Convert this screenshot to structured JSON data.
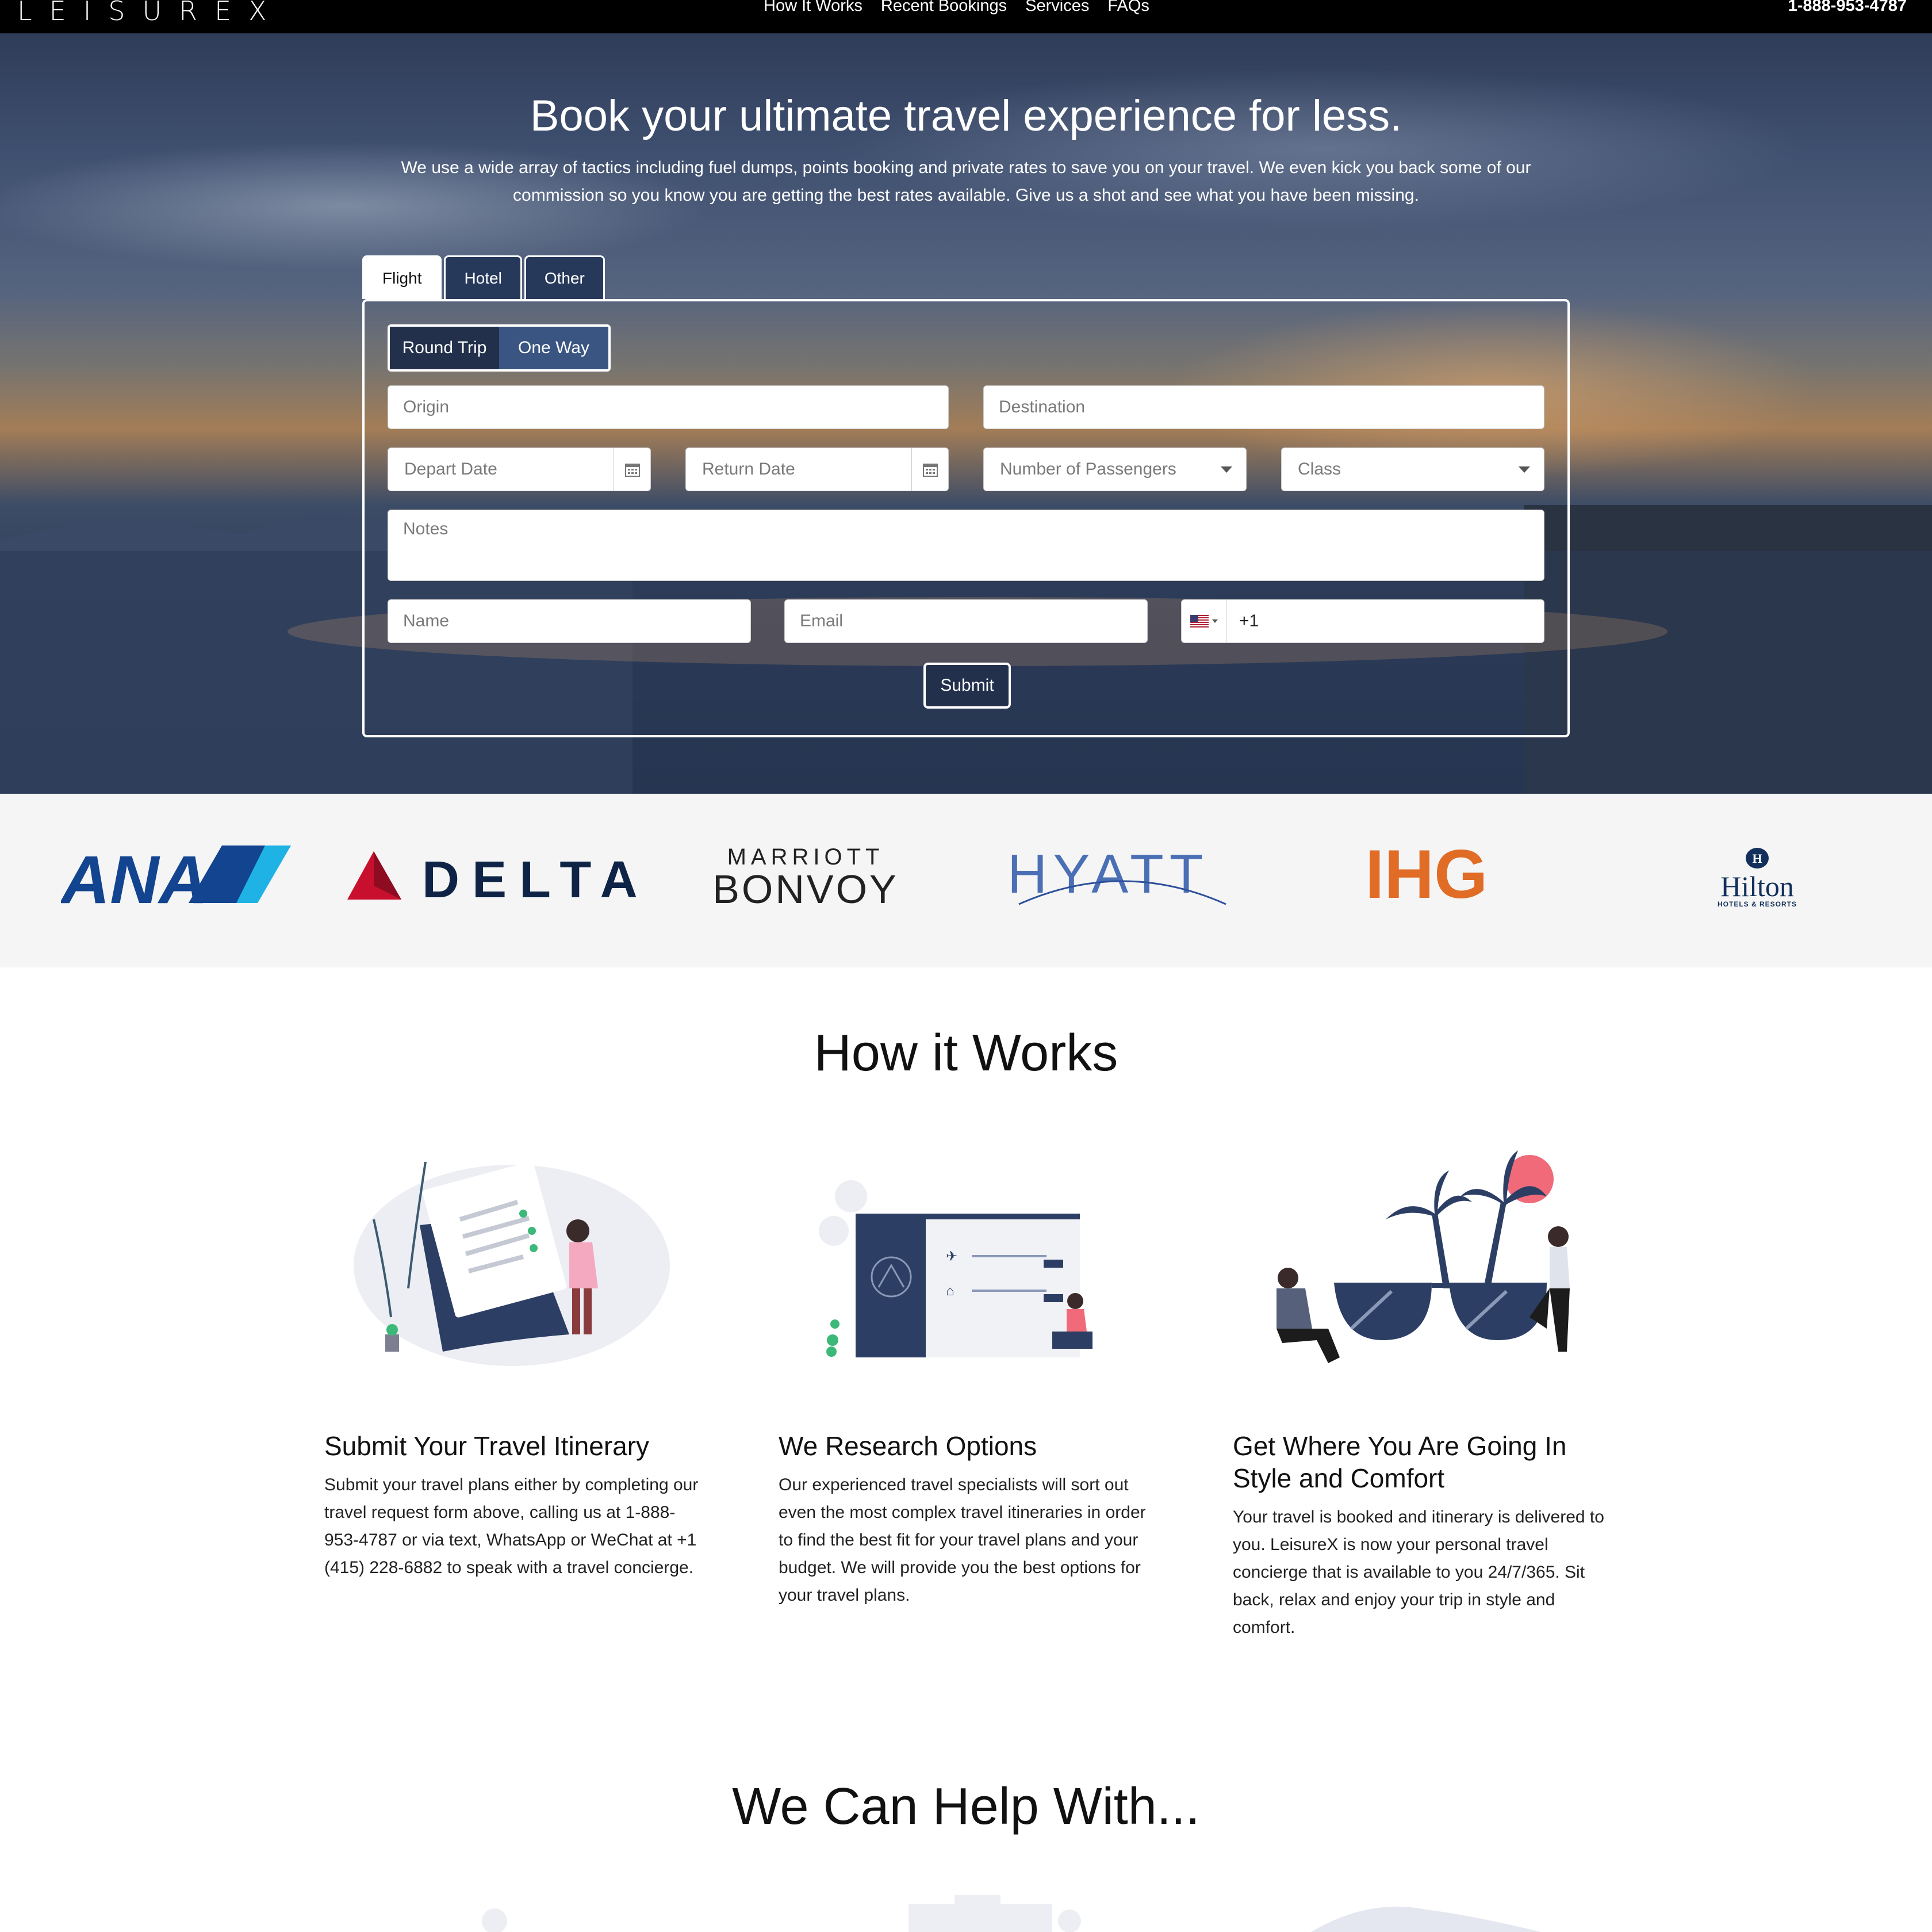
{
  "nav": {
    "logo": "LEISUREX",
    "links": [
      "How It Works",
      "Recent Bookings",
      "Services",
      "FAQs"
    ],
    "phone": "1-888-953-4787"
  },
  "hero": {
    "title": "Book your ultimate travel experience for less.",
    "subtitle": "We use a wide array of tactics including fuel dumps, points booking and private rates to save you on your travel. We even kick you back some of our commission so you know you are getting the best rates available. Give us a shot and see what you have been missing."
  },
  "tabs": [
    "Flight",
    "Hotel",
    "Other"
  ],
  "form": {
    "trip_types": [
      "Round Trip",
      "One Way"
    ],
    "origin_placeholder": "Origin",
    "destination_placeholder": "Destination",
    "depart_placeholder": "Depart Date",
    "return_placeholder": "Return Date",
    "passengers_placeholder": "Number of Passengers",
    "class_placeholder": "Class",
    "notes_placeholder": "Notes",
    "name_placeholder": "Name",
    "email_placeholder": "Email",
    "phone_prefix": "+1",
    "submit_label": "Submit"
  },
  "partners": {
    "ana": "ANA",
    "delta": "DELTA",
    "marriott_top": "MARRIOTT",
    "marriott_bottom": "BONVOY",
    "hyatt": "HYATT",
    "ihg": "IHG",
    "hilton": "Hilton",
    "hilton_sub": "HOTELS & RESORTS"
  },
  "how_it_works": {
    "title": "How it Works",
    "steps": [
      {
        "title": "Submit Your Travel Itinerary",
        "text": "Submit your travel plans either by completing our travel request form above, calling us at 1-888-953-4787 or via text, WhatsApp or WeChat at +1 (415) 228-6882 to speak with a travel concierge."
      },
      {
        "title": "We Research Options",
        "text": "Our experienced travel specialists will sort out even the most complex travel itineraries in order to find the best fit for your travel plans and your budget. We will provide you the best options for your travel plans."
      },
      {
        "title": "Get Where You Are Going In Style and Comfort",
        "text": "Your travel is booked and itinerary is delivered to you. LeisureX is now your personal travel concierge that is available to you 24/7/365. Sit back, relax and enjoy your trip in style and comfort."
      }
    ]
  },
  "help": {
    "title": "We Can Help With..."
  },
  "colors": {
    "navy": "#22304b",
    "delta_red": "#c8102e",
    "ihg_orange": "#e06c25",
    "ana_blue": "#13448f",
    "hyatt_blue": "#4a6fb5"
  }
}
